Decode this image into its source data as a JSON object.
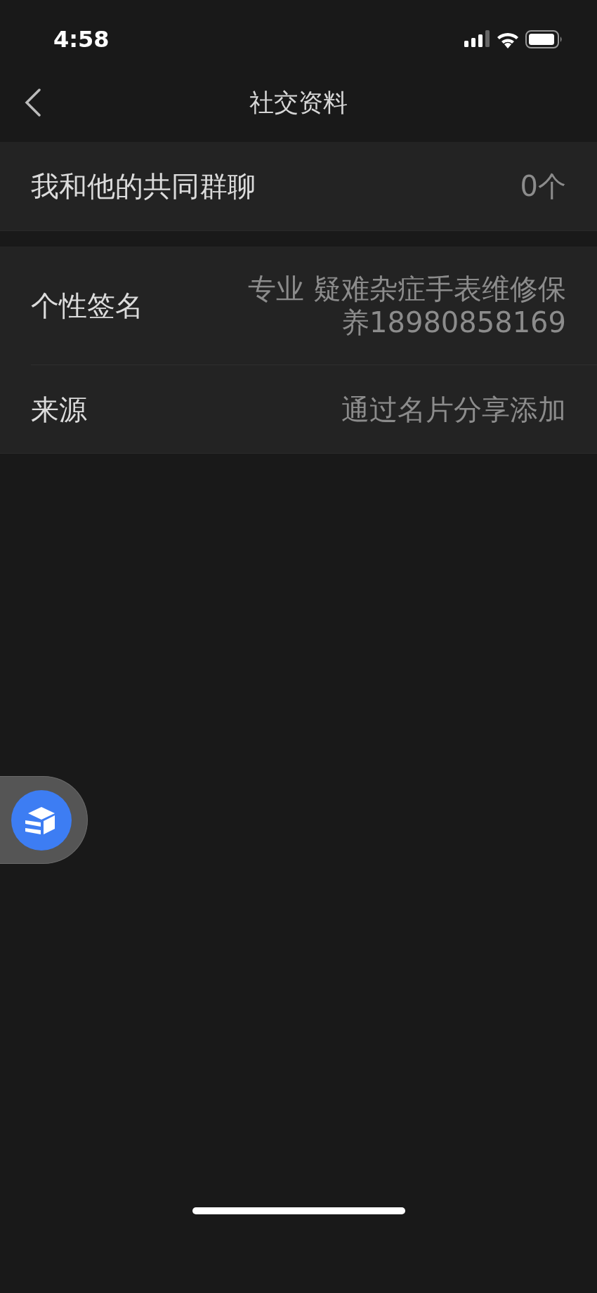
{
  "status_bar": {
    "time": "4:58"
  },
  "nav": {
    "title": "社交资料"
  },
  "sections": [
    {
      "rows": [
        {
          "label": "我和他的共同群聊",
          "value": "0个"
        }
      ]
    },
    {
      "rows": [
        {
          "label": "个性签名",
          "value": "专业 疑难杂症手表维修保养18980858169"
        },
        {
          "label": "来源",
          "value": "通过名片分享添加"
        }
      ]
    }
  ]
}
